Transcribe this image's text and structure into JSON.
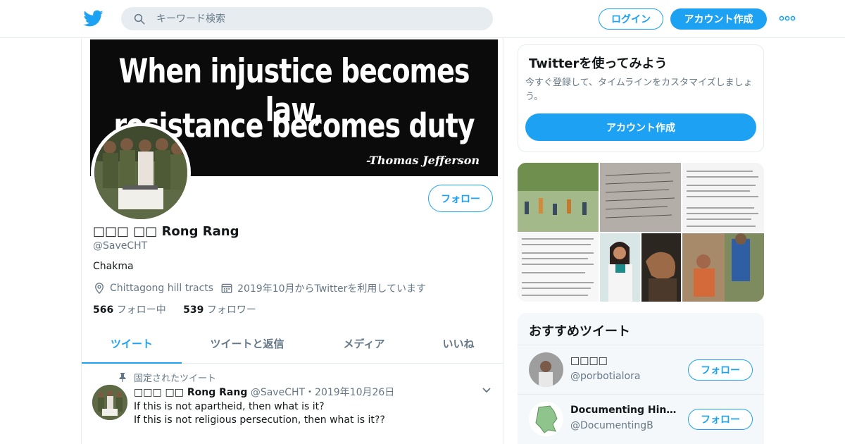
{
  "colors": {
    "accent": "#1da1f2",
    "text": "#14171a",
    "muted": "#657786",
    "border": "#e6ecf0"
  },
  "header": {
    "logo_icon": "twitter-bird-icon",
    "search_placeholder": "キーワード検索",
    "login_label": "ログイン",
    "signup_label": "アカウント作成",
    "more_icon": "more-dots-icon"
  },
  "banner": {
    "line1": "When injustice becomes law,",
    "line2": "resistance becomes duty",
    "attribution": "-Thomas Jefferson"
  },
  "profile": {
    "name": "□□□ □□ Rong Rang",
    "handle": "@SaveCHT",
    "bio": "Chakma",
    "location": "Chittagong hill tracts",
    "joined": "2019年10月からTwitterを利用しています",
    "following_count": "566",
    "following_label": "フォロー中",
    "followers_count": "539",
    "followers_label": "フォロワー",
    "follow_label": "フォロー"
  },
  "tabs": [
    {
      "label": "ツイート",
      "active": true
    },
    {
      "label": "ツイートと返信",
      "active": false
    },
    {
      "label": "メディア",
      "active": false
    },
    {
      "label": "いいね",
      "active": false
    }
  ],
  "pinned_tweet": {
    "pinned_label": "固定されたツイート",
    "author_name": "□□□ □□ Rong Rang",
    "author_handle": "@SaveCHT",
    "date": "・2019年10月26日",
    "text": "If this is not apartheid, then what is it?\nIf this is not religious persecution, then what is it??"
  },
  "signup_card": {
    "title": "Twitterを使ってみよう",
    "description": "今すぐ登録して、タイムラインをカスタマイズしましょう。",
    "button_label": "アカウント作成"
  },
  "recommendations": {
    "title": "おすすめツイート",
    "follow_label": "フォロー",
    "items": [
      {
        "name": "□□□□",
        "handle": "@porbotialora"
      },
      {
        "name": "Documenting Hindup...",
        "handle": "@DocumentingB"
      }
    ]
  }
}
